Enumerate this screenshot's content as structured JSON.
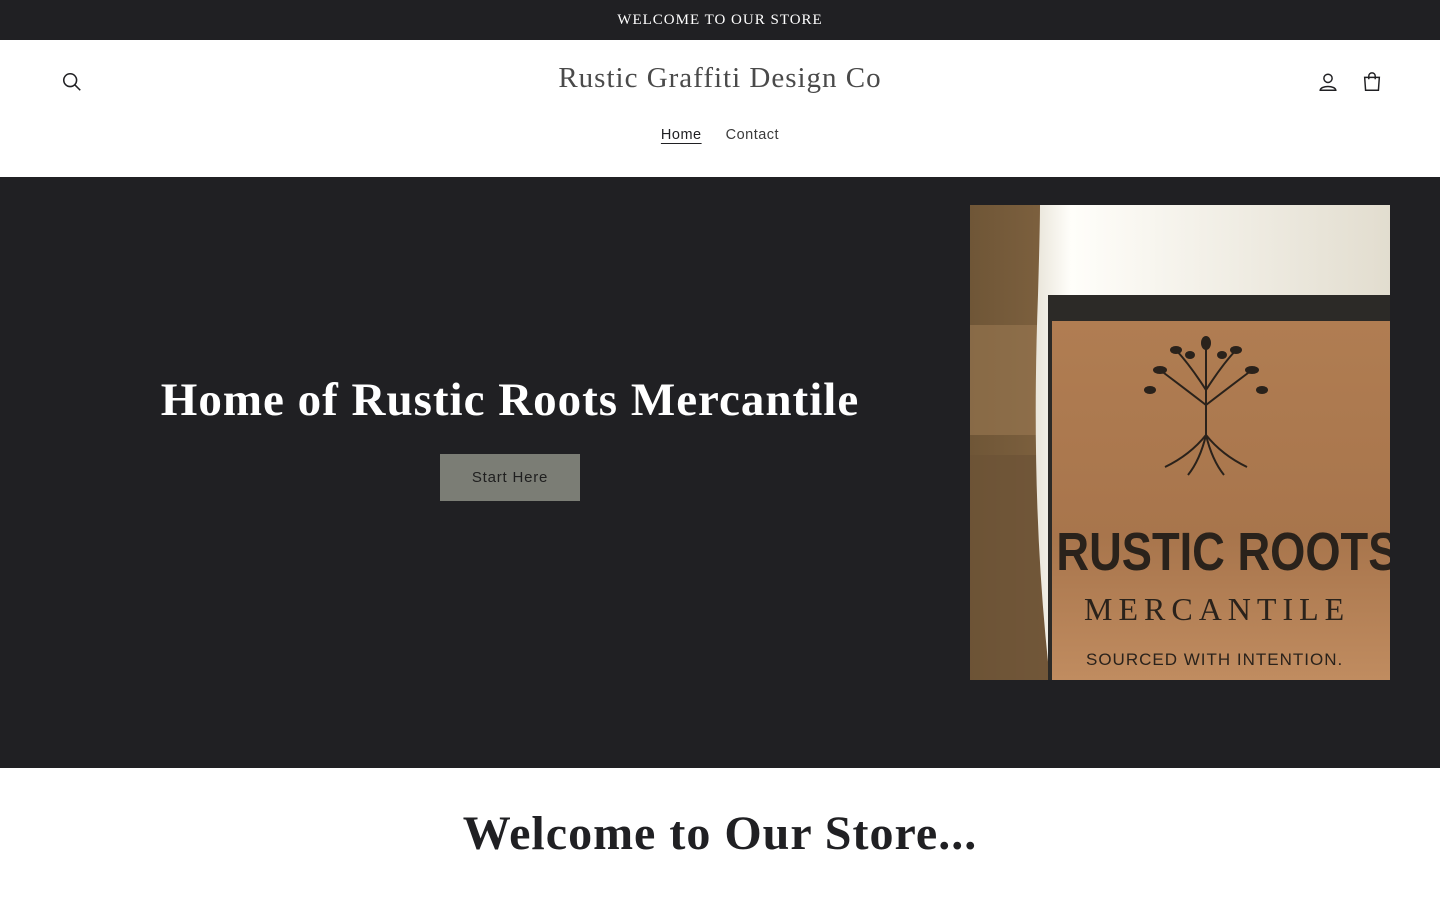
{
  "announcement": {
    "text": "WELCOME TO OUR STORE"
  },
  "header": {
    "logo_text": "Rustic Graffiti Design Co",
    "nav": [
      {
        "label": "Home",
        "active": true
      },
      {
        "label": "Contact",
        "active": false
      }
    ],
    "icons": {
      "search": "search-icon",
      "account": "user-icon",
      "cart": "cart-icon"
    }
  },
  "hero": {
    "title": "Home of Rustic Roots Mercantile",
    "button_label": "Start Here",
    "image_label": {
      "brand_line1": "RUSTIC ROOTS",
      "brand_line2": "MERCANTILE",
      "tagline": "SOURCED WITH INTENTION."
    }
  },
  "welcome": {
    "title": "Welcome to Our Store..."
  },
  "colors": {
    "dark": "#202023",
    "button": "#7b7d75",
    "white": "#ffffff",
    "kraft": "#a8754c"
  }
}
